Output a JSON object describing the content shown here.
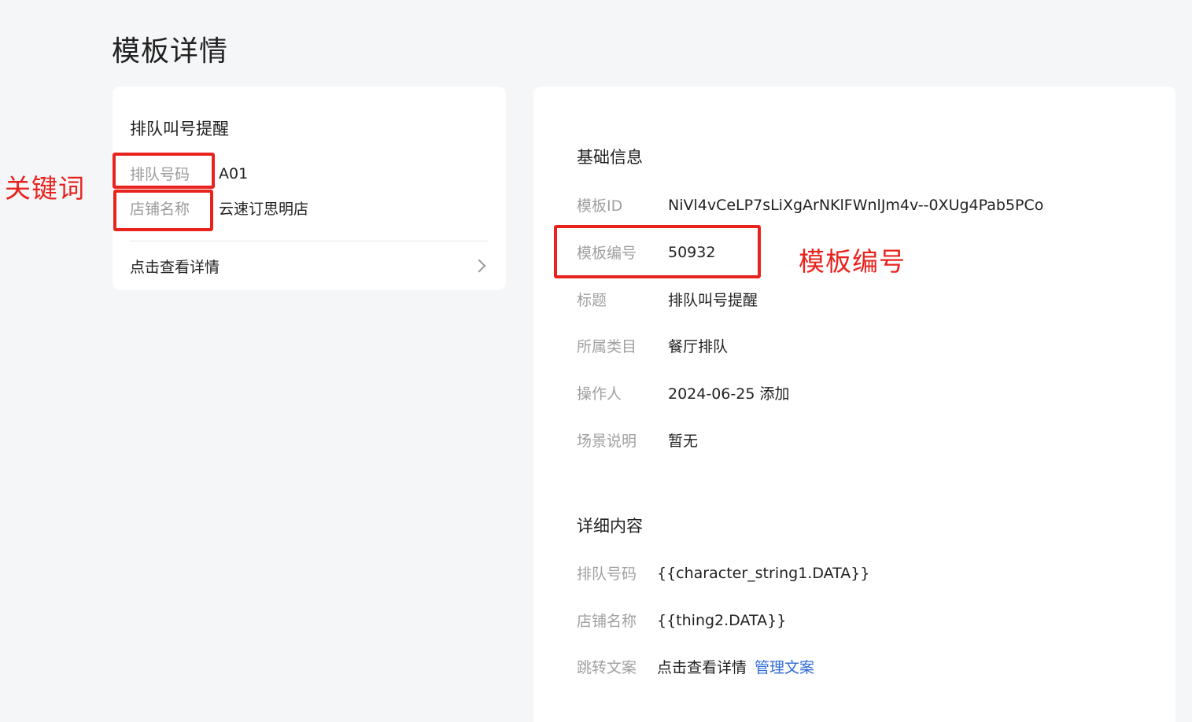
{
  "page": {
    "title": "模板详情"
  },
  "preview": {
    "title": "排队叫号提醒",
    "fields": [
      {
        "key": "排队号码",
        "value": "A01"
      },
      {
        "key": "店铺名称",
        "value": "云速订思明店"
      }
    ],
    "link_label": "点击查看详情"
  },
  "annotations": {
    "keyword_label": "关键词",
    "template_no_label": "模板编号",
    "color": "#e8231e"
  },
  "basic_info": {
    "section_title": "基础信息",
    "rows": [
      {
        "key": "模板ID",
        "value": "NiVl4vCeLP7sLiXgArNKlFWnlJm4v--0XUg4Pab5PCo"
      },
      {
        "key": "模板编号",
        "value": "50932"
      },
      {
        "key": "标题",
        "value": "排队叫号提醒"
      },
      {
        "key": "所属类目",
        "value": "餐厅排队"
      },
      {
        "key": "操作人",
        "value": "2024-06-25 添加"
      },
      {
        "key": "场景说明",
        "value": "暂无"
      }
    ]
  },
  "detail_content": {
    "section_title": "详细内容",
    "rows": [
      {
        "key": "排队号码",
        "value": "{{character_string1.DATA}}"
      },
      {
        "key": "店铺名称",
        "value": "{{thing2.DATA}}"
      },
      {
        "key": "跳转文案",
        "value": "点击查看详情",
        "link": "管理文案"
      }
    ]
  },
  "colors": {
    "link_blue": "#2f6bd6",
    "background": "#f5f6f8"
  }
}
